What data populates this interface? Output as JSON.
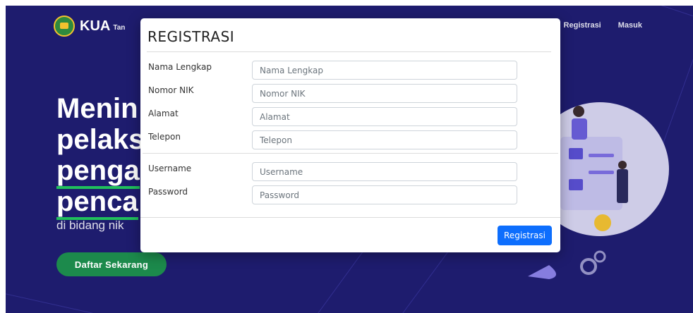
{
  "brand": {
    "name": "KUA",
    "sub": "Tan"
  },
  "nav": {
    "items": [
      "Registrasi",
      "Masuk"
    ]
  },
  "hero": {
    "lines": [
      "Menin",
      "pelaks",
      "penga",
      "penca"
    ],
    "subtitle": "di bidang nik",
    "cta_label": "Daftar Sekarang"
  },
  "modal": {
    "title": "REGISTRASI",
    "fields": [
      {
        "label": "Nama Lengkap",
        "placeholder": "Nama Lengkap",
        "value": ""
      },
      {
        "label": "Nomor NIK",
        "placeholder": "Nomor NIK",
        "value": ""
      },
      {
        "label": "Alamat",
        "placeholder": "Alamat",
        "value": ""
      },
      {
        "label": "Telepon",
        "placeholder": "Telepon",
        "value": ""
      },
      {
        "label": "Username",
        "placeholder": "Username",
        "value": ""
      },
      {
        "label": "Password",
        "placeholder": "Password",
        "value": ""
      }
    ],
    "submit_label": "Registrasi"
  },
  "colors": {
    "page_bg": "#1e1c6e",
    "accent_green": "#1c8a4c",
    "primary_button": "#0d6efd"
  }
}
